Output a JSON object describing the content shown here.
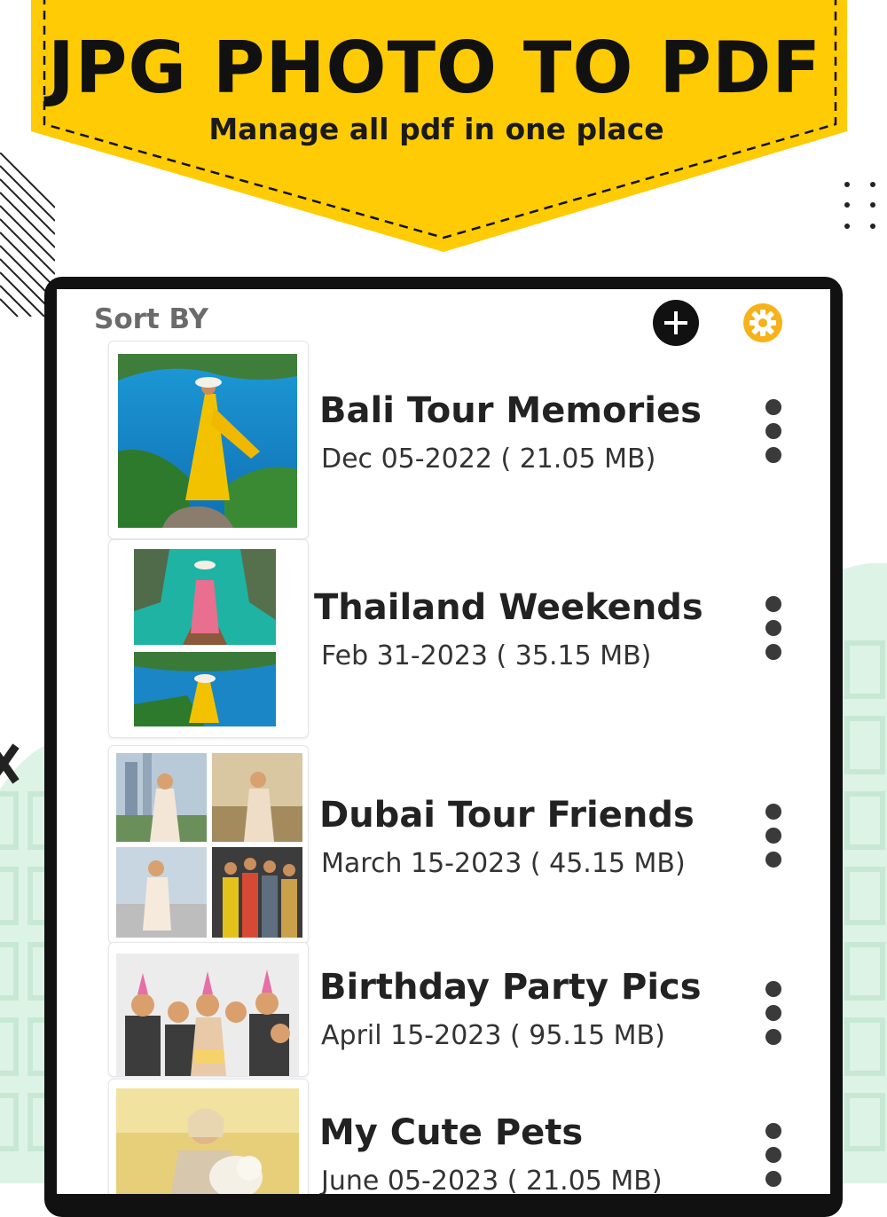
{
  "colors": {
    "accent_yellow": "#FFCB05",
    "gear_orange": "#F6B21A",
    "mint": "#DDF3E6",
    "frame": "#111111"
  },
  "banner": {
    "title": "JPG PHOTO TO PDF",
    "subtitle": "Manage all pdf in one place"
  },
  "toolbar": {
    "sort_label": "Sort BY",
    "add_icon": "plus-icon",
    "settings_icon": "gear-icon"
  },
  "files": [
    {
      "title": "Bali Tour Memories",
      "meta": "Dec 05-2022 ( 21.05 MB)",
      "thumb": "bali-photo"
    },
    {
      "title": "Thailand Weekends",
      "meta": "Feb 31-2023 ( 35.15 MB)",
      "thumb": "thailand-collage"
    },
    {
      "title": "Dubai Tour Friends",
      "meta": "March 15-2023 ( 45.15 MB)",
      "thumb": "dubai-collage"
    },
    {
      "title": "Birthday Party Pics",
      "meta": "April 15-2023 ( 95.15 MB)",
      "thumb": "party-photo"
    },
    {
      "title": "My Cute Pets",
      "meta": "June 05-2023 ( 21.05 MB)",
      "thumb": "pets-photo"
    }
  ]
}
